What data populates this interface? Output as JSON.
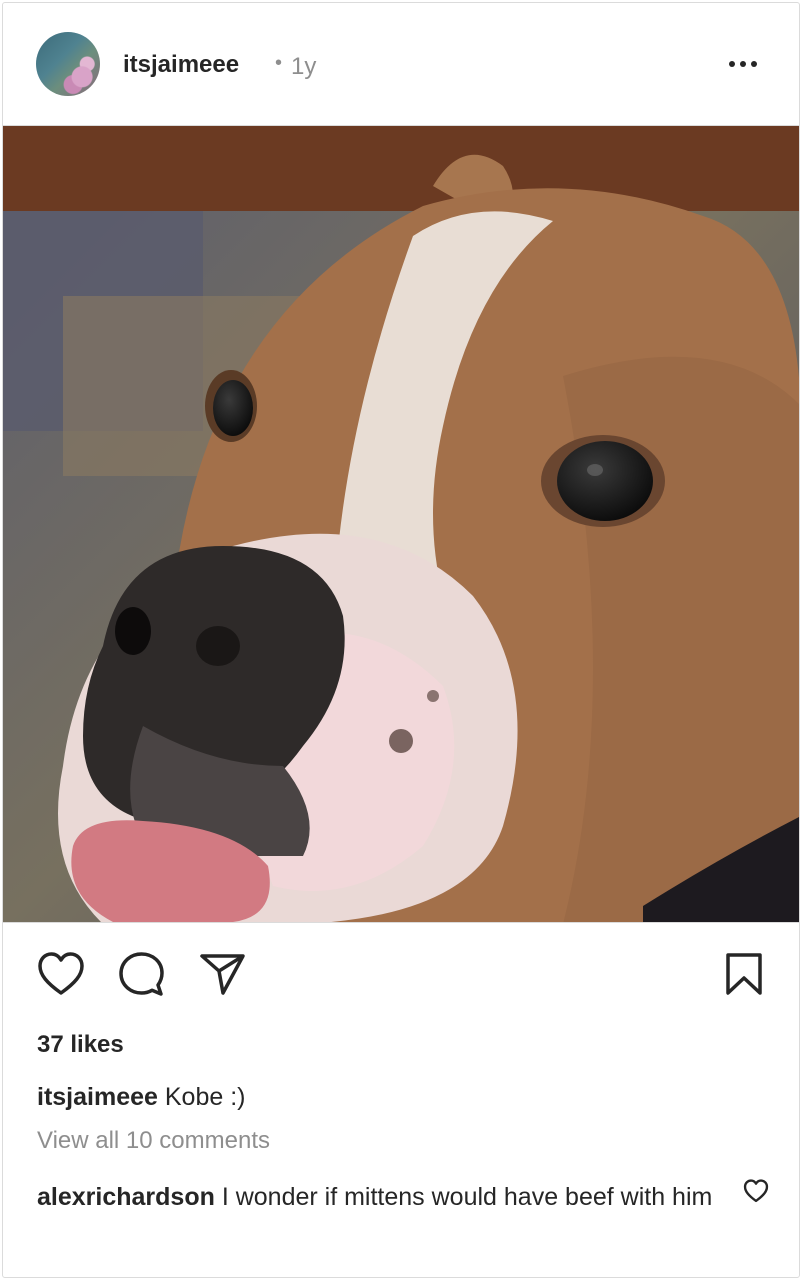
{
  "post": {
    "username": "itsjaimeee",
    "separator": "•",
    "time": "1y",
    "likes": "37 likes",
    "caption": {
      "username": "itsjaimeee",
      "text": "Kobe :)"
    },
    "view_comments": "View all 10 comments",
    "comment": {
      "username": "alexrichardson",
      "text": "I wonder if mittens would have beef with him"
    },
    "icons": {
      "more": "more-horizontal-icon",
      "like": "heart-icon",
      "comment": "comment-bubble-icon",
      "share": "paper-plane-icon",
      "save": "bookmark-icon",
      "comment_like": "small-heart-icon"
    }
  }
}
